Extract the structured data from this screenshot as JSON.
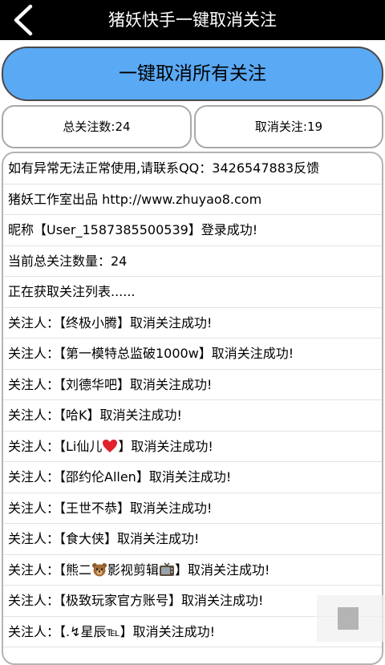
{
  "header": {
    "title": "猪妖快手一键取消关注"
  },
  "main_button": {
    "label": "一键取消所有关注"
  },
  "stats": {
    "total": "总关注数:24",
    "cancelled": "取消关注:19"
  },
  "log": {
    "lines": [
      "如有异常无法正常使用,请联系QQ：3426547883反馈",
      "猪妖工作室出品 http://www.zhuyao8.com",
      "昵称【User_1587385500539】登录成功!",
      "当前总关注数量：24",
      "正在获取关注列表......",
      "关注人：【终极小腾】取消关注成功!",
      "关注人：【第一模特总监破1000w】取消关注成功!",
      "关注人：【刘德华吧】取消关注成功!",
      "关注人：【哈K】取消关注成功!"
    ],
    "emoji_lines": [
      {
        "prefix": "关注人：【Li仙儿",
        "icon": "heart-emoji-icon",
        "suffix": "】取消关注成功!"
      }
    ],
    "lines_b": [
      "关注人：【邵约伦Allen】取消关注成功!",
      "关注人：【王世不恭】取消关注成功!",
      "关注人：【食大侠】取消关注成功!"
    ],
    "emoji_line_2": {
      "prefix": "关注人：【熊二",
      "icon1": "bear-emoji-icon",
      "middle": "影视剪辑",
      "icon2": "tv-emoji-icon",
      "suffix": "】取消关注成功!"
    },
    "lines_c": [
      "关注人：【极致玩家官方账号】取消关注成功!",
      "关注人：【.↯星辰℡】取消关注成功!"
    ]
  },
  "colors": {
    "titlebar": "#000000",
    "button": "#5aa9f4"
  }
}
